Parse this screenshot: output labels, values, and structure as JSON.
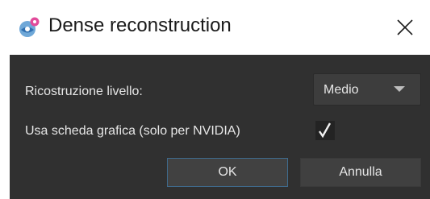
{
  "window": {
    "title": "Dense reconstruction",
    "app_icon": "app-logo-icon",
    "close_icon": "close-icon"
  },
  "form": {
    "level_label": "Ricostruzione livello:",
    "level_select": {
      "selected": "Medio",
      "arrow_icon": "chevron-down-icon"
    },
    "gpu_label": "Usa scheda grafica (solo per NVIDIA)",
    "gpu_checkbox": {
      "checked": true,
      "check_icon": "checkmark-icon"
    }
  },
  "buttons": {
    "ok": "OK",
    "cancel": "Annulla"
  },
  "colors": {
    "panel_bg": "#303030",
    "text": "#e6e6e6",
    "focus_border": "#3f6a8c"
  }
}
